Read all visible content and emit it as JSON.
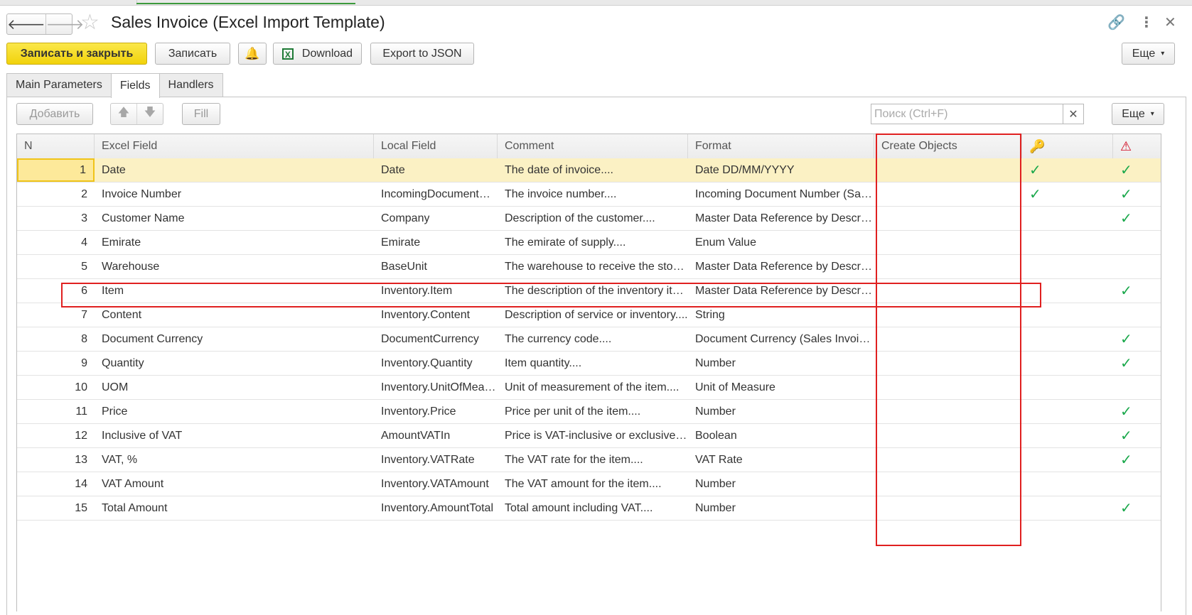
{
  "window": {
    "title": "Sales Invoice (Excel Import Template)"
  },
  "toolbar": {
    "save_close_label": "Записать и закрыть",
    "save_label": "Записать",
    "download_label": "Download",
    "export_json_label": "Export to JSON",
    "more_label": "Еще"
  },
  "tabs": [
    {
      "label": "Main Parameters"
    },
    {
      "label": "Fields"
    },
    {
      "label": "Handlers"
    }
  ],
  "fields_toolbar": {
    "add_label": "Добавить",
    "fill_label": "Fill",
    "search_placeholder": "Поиск (Ctrl+F)",
    "more_label": "Еще"
  },
  "table": {
    "columns": {
      "n": "N",
      "excel_field": "Excel Field",
      "local_field": "Local Field",
      "comment": "Comment",
      "format": "Format",
      "create_objects": "Create Objects"
    },
    "rows": [
      {
        "n": "1",
        "excel": "Date",
        "local": "Date",
        "comment": "The date of invoice....",
        "format": "Date DD/MM/YYYY",
        "key": true,
        "required": true
      },
      {
        "n": "2",
        "excel": "Invoice Number",
        "local": "IncomingDocumentNumber",
        "comment": "The invoice number....",
        "format": "Incoming Document Number (Sales Invoice)",
        "key": true,
        "required": true
      },
      {
        "n": "3",
        "excel": "Customer Name",
        "local": "Company",
        "comment": "Description of the customer....",
        "format": "Master Data Reference by Description",
        "key": false,
        "required": true
      },
      {
        "n": "4",
        "excel": "Emirate",
        "local": "Emirate",
        "comment": "The emirate of supply....",
        "format": "Enum Value",
        "key": false,
        "required": false
      },
      {
        "n": "5",
        "excel": "Warehouse",
        "local": "BaseUnit",
        "comment": "The warehouse to receive the stock....",
        "format": "Master Data Reference by Description",
        "key": false,
        "required": false
      },
      {
        "n": "6",
        "excel": "Item",
        "local": "Inventory.Item",
        "comment": "The description of the inventory item....",
        "format": "Master Data Reference by Description",
        "key": false,
        "required": true
      },
      {
        "n": "7",
        "excel": "Content",
        "local": "Inventory.Content",
        "comment": "Description of service or inventory....",
        "format": "String",
        "key": false,
        "required": false
      },
      {
        "n": "8",
        "excel": "Document Currency",
        "local": "DocumentCurrency",
        "comment": "The currency code....",
        "format": "Document Currency (Sales Invoice)",
        "key": false,
        "required": true
      },
      {
        "n": "9",
        "excel": "Quantity",
        "local": "Inventory.Quantity",
        "comment": "Item quantity....",
        "format": "Number",
        "key": false,
        "required": true
      },
      {
        "n": "10",
        "excel": "UOM",
        "local": "Inventory.UnitOfMeasure",
        "comment": "Unit of measurement of the item....",
        "format": "Unit of Measure",
        "key": false,
        "required": false
      },
      {
        "n": "11",
        "excel": "Price",
        "local": "Inventory.Price",
        "comment": "Price per unit of the item....",
        "format": "Number",
        "key": false,
        "required": true
      },
      {
        "n": "12",
        "excel": "Inclusive of VAT",
        "local": "AmountVATIn",
        "comment": "Price is VAT-inclusive or exclusive....",
        "format": "Boolean",
        "key": false,
        "required": true
      },
      {
        "n": "13",
        "excel": "VAT, %",
        "local": "Inventory.VATRate",
        "comment": "The VAT rate for the item....",
        "format": "VAT Rate",
        "key": false,
        "required": true
      },
      {
        "n": "14",
        "excel": "VAT Amount",
        "local": "Inventory.VATAmount",
        "comment": "The VAT amount for the item....",
        "format": "Number",
        "key": false,
        "required": false
      },
      {
        "n": "15",
        "excel": "Total Amount",
        "local": "Inventory.AmountTotal",
        "comment": "Total amount including VAT....",
        "format": "Number",
        "key": false,
        "required": true
      }
    ]
  },
  "colors": {
    "primary_button": "#f1d20b",
    "selected_row": "#fbf1c4",
    "check": "#1aa84b",
    "annotation": "#e02020"
  }
}
